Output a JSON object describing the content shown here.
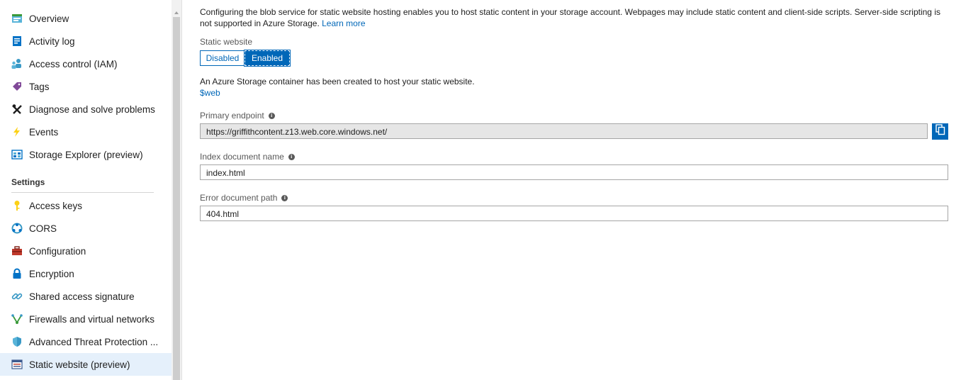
{
  "sidebar": {
    "items": [
      {
        "label": "Overview",
        "icon": "overview-icon"
      },
      {
        "label": "Activity log",
        "icon": "activity-log-icon"
      },
      {
        "label": "Access control (IAM)",
        "icon": "iam-people-icon"
      },
      {
        "label": "Tags",
        "icon": "tag-icon"
      },
      {
        "label": "Diagnose and solve problems",
        "icon": "wrench-cross-icon"
      },
      {
        "label": "Events",
        "icon": "lightning-icon"
      },
      {
        "label": "Storage Explorer (preview)",
        "icon": "storage-explorer-icon"
      }
    ],
    "settings_header": "Settings",
    "settings_items": [
      {
        "label": "Access keys",
        "icon": "key-icon"
      },
      {
        "label": "CORS",
        "icon": "cors-icon"
      },
      {
        "label": "Configuration",
        "icon": "toolbox-icon"
      },
      {
        "label": "Encryption",
        "icon": "lock-icon"
      },
      {
        "label": "Shared access signature",
        "icon": "link-icon"
      },
      {
        "label": "Firewalls and virtual networks",
        "icon": "firewall-icon"
      },
      {
        "label": "Advanced Threat Protection ...",
        "icon": "shield-icon"
      },
      {
        "label": "Static website (preview)",
        "icon": "static-website-icon",
        "selected": true
      }
    ]
  },
  "main": {
    "description": "Configuring the blob service for static website hosting enables you to host static content in your storage account. Webpages may include static content and client-side scripts. Server-side scripting is not supported in Azure Storage.",
    "learn_more": "Learn more",
    "static_website_label": "Static website",
    "toggle": {
      "disabled_label": "Disabled",
      "enabled_label": "Enabled",
      "selected": "Enabled"
    },
    "container_message": "An Azure Storage container has been created to host your static website.",
    "container_link": "$web",
    "primary_endpoint_label": "Primary endpoint",
    "primary_endpoint_value": "https://griffithcontent.z13.web.core.windows.net/",
    "index_label": "Index document name",
    "index_value": "index.html",
    "error_label": "Error document path",
    "error_value": "404.html"
  },
  "colors": {
    "accent": "#0067b8",
    "selected_bg": "#e5f0fb"
  }
}
